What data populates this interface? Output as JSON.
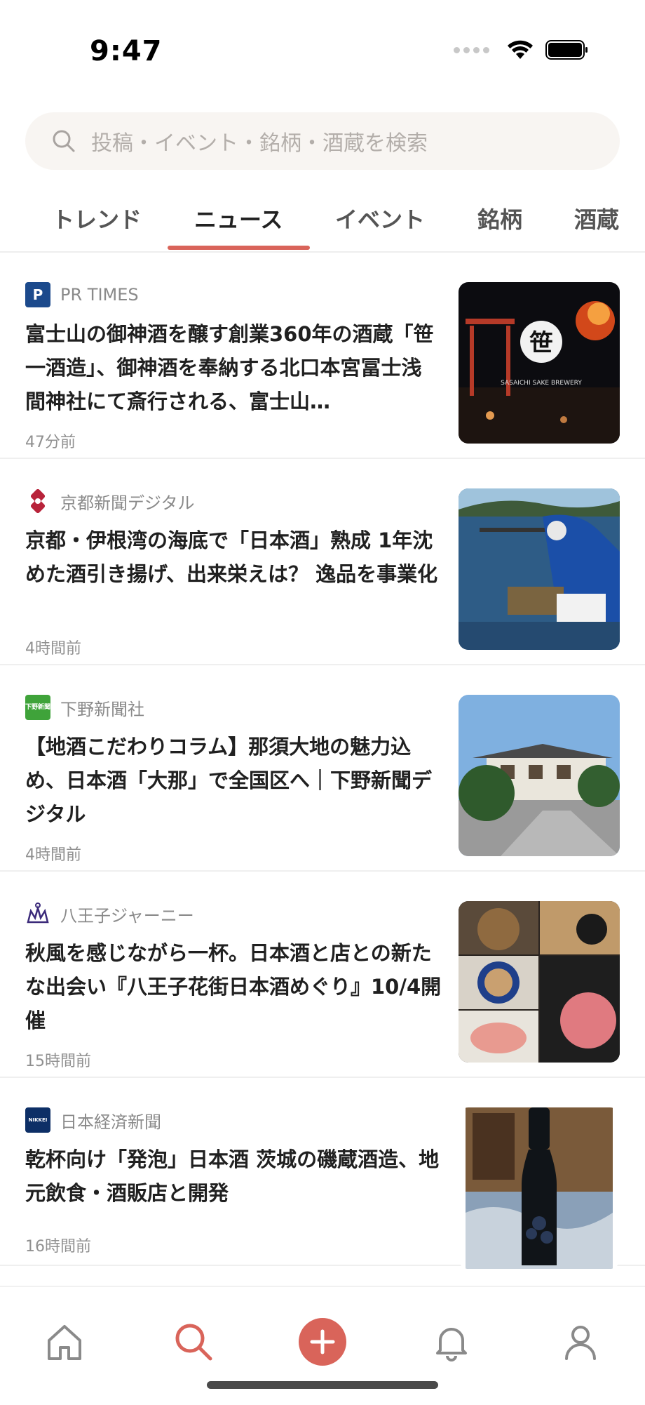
{
  "status_bar": {
    "time": "9:47"
  },
  "search": {
    "placeholder": "投稿・イベント・銘柄・酒蔵を検索"
  },
  "tabs": [
    {
      "label": "トレンド"
    },
    {
      "label": "ニュース"
    },
    {
      "label": "イベント"
    },
    {
      "label": "銘柄"
    },
    {
      "label": "酒蔵"
    }
  ],
  "active_tab": "ニュース",
  "news": [
    {
      "source": "PR TIMES",
      "headline": "富士山の御神酒を醸す創業360年の酒蔵「笹一酒造」、御神酒を奉納する北口本宮冨士浅間神社にて斎行される、富士山…",
      "time": "47分前",
      "thumb_text": "SASAICHI SAKE BREWERY"
    },
    {
      "source": "京都新聞デジタル",
      "headline": "京都・伊根湾の海底で「日本酒」熟成 1年沈めた酒引き揚げ、出来栄えは？ 逸品を事業化",
      "time": "4時間前"
    },
    {
      "source": "下野新聞社",
      "headline": "【地酒こだわりコラム】那須大地の魅力込め、日本酒「大那」で全国区へ｜下野新聞デジタル",
      "time": "4時間前"
    },
    {
      "source": "八王子ジャーニー",
      "headline": "秋風を感じながら一杯。日本酒と店との新たな出会い『八王子花街日本酒めぐり』10/4開催",
      "time": "15時間前"
    },
    {
      "source": "日本経済新聞",
      "headline": "乾杯向け「発泡」日本酒 茨城の磯蔵酒造、地元飲食・酒販店と開発",
      "time": "16時間前"
    }
  ],
  "icons": {
    "pr_times": "P",
    "shimotsuke": "下野新聞",
    "nikkei": "NIKKEI"
  },
  "colors": {
    "accent": "#d9645a"
  }
}
